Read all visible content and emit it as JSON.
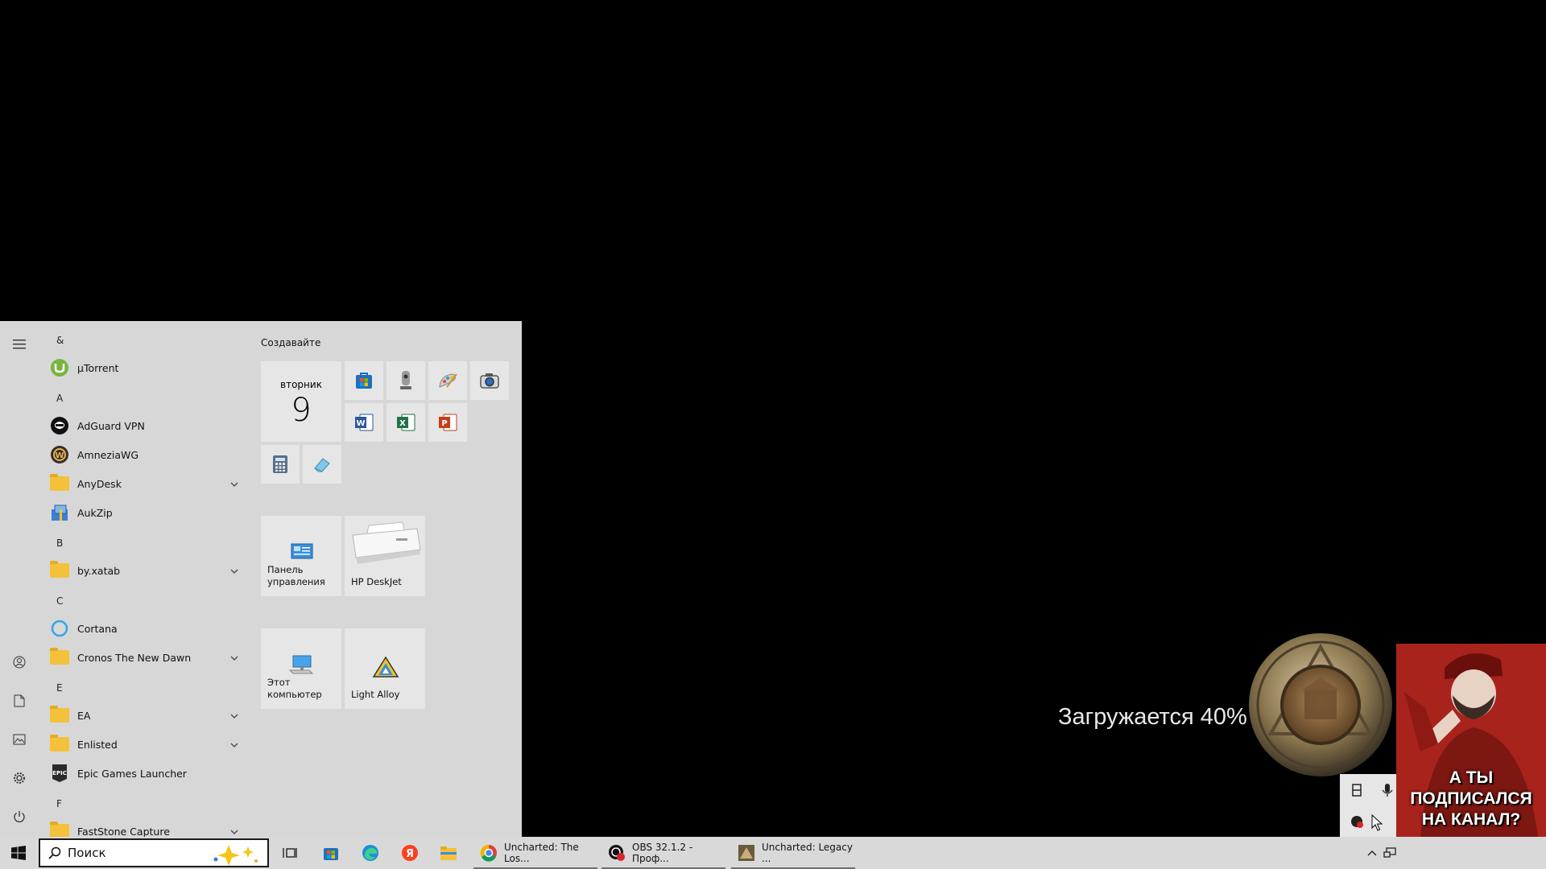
{
  "start_menu": {
    "app_list": [
      {
        "type": "letter",
        "text": "&"
      },
      {
        "type": "app",
        "label": "µTorrent",
        "icon": "utorrent-icon"
      },
      {
        "type": "letter",
        "text": "A"
      },
      {
        "type": "app",
        "label": "AdGuard VPN",
        "icon": "adguard-vpn-icon"
      },
      {
        "type": "app",
        "label": "AmneziaWG",
        "icon": "amneziawg-icon"
      },
      {
        "type": "folder",
        "label": "AnyDesk",
        "icon": "folder-icon"
      },
      {
        "type": "app",
        "label": "AukZip",
        "icon": "aukzip-icon"
      },
      {
        "type": "letter",
        "text": "B"
      },
      {
        "type": "folder",
        "label": "by.xatab",
        "icon": "folder-icon"
      },
      {
        "type": "letter",
        "text": "C"
      },
      {
        "type": "app",
        "label": "Cortana",
        "icon": "cortana-icon"
      },
      {
        "type": "folder",
        "label": "Cronos The New Dawn",
        "icon": "folder-icon"
      },
      {
        "type": "letter",
        "text": "E"
      },
      {
        "type": "folder",
        "label": "EA",
        "icon": "folder-icon"
      },
      {
        "type": "folder",
        "label": "Enlisted",
        "icon": "folder-icon"
      },
      {
        "type": "app",
        "label": "Epic Games Launcher",
        "icon": "epic-games-icon"
      },
      {
        "type": "letter",
        "text": "F"
      },
      {
        "type": "folder",
        "label": "FastStone Capture",
        "icon": "folder-icon"
      }
    ],
    "tiles": {
      "group_title": "Создавайте",
      "calendar": {
        "weekday": "вторник",
        "day": "9"
      },
      "control_panel_label": "Панель управления",
      "hp_label": "HP DeskJet",
      "this_pc_label": "Этот компьютер",
      "light_alloy_label": "Light Alloy"
    }
  },
  "taskbar": {
    "search_placeholder": "Поиск",
    "tasks": [
      {
        "label": "Uncharted: The Los...",
        "icon": "chrome-icon"
      },
      {
        "label": "OBS 32.1.2 - Проф...",
        "icon": "obs-icon"
      },
      {
        "label": "Uncharted: Legacy ...",
        "icon": "uncharted-game-icon"
      }
    ]
  },
  "overlay": {
    "loading_text": "Загружается 40%",
    "poster_line1": "А ТЫ ПОДПИСАЛСЯ",
    "poster_line2": "НА КАНАЛ?"
  }
}
